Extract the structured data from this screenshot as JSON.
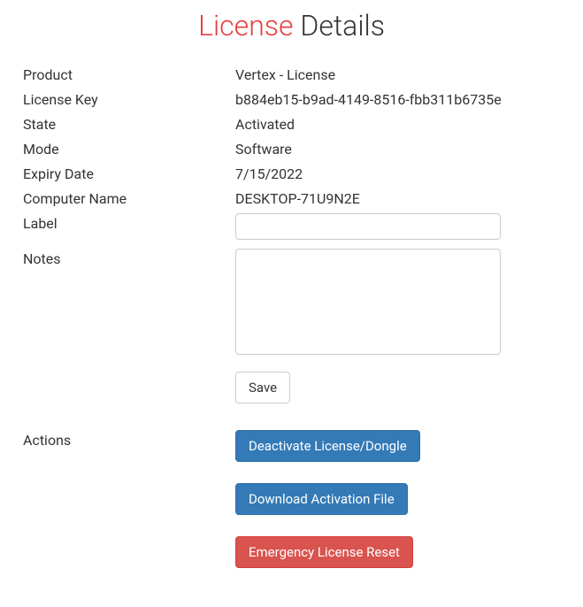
{
  "title": {
    "accent": "License",
    "rest": "Details"
  },
  "fields": {
    "product": {
      "label": "Product",
      "value": "Vertex - License"
    },
    "license_key": {
      "label": "License Key",
      "value": "b884eb15-b9ad-4149-8516-fbb311b6735e"
    },
    "state": {
      "label": "State",
      "value": "Activated"
    },
    "mode": {
      "label": "Mode",
      "value": "Software"
    },
    "expiry": {
      "label": "Expiry Date",
      "value": "7/15/2022"
    },
    "computer": {
      "label": "Computer Name",
      "value": "DESKTOP-71U9N2E"
    },
    "label_field": {
      "label": "Label",
      "value": ""
    },
    "notes": {
      "label": "Notes",
      "value": ""
    }
  },
  "buttons": {
    "save": "Save",
    "actions_label": "Actions",
    "deactivate": "Deactivate License/Dongle",
    "download": "Download Activation File",
    "emergency": "Emergency License Reset"
  }
}
